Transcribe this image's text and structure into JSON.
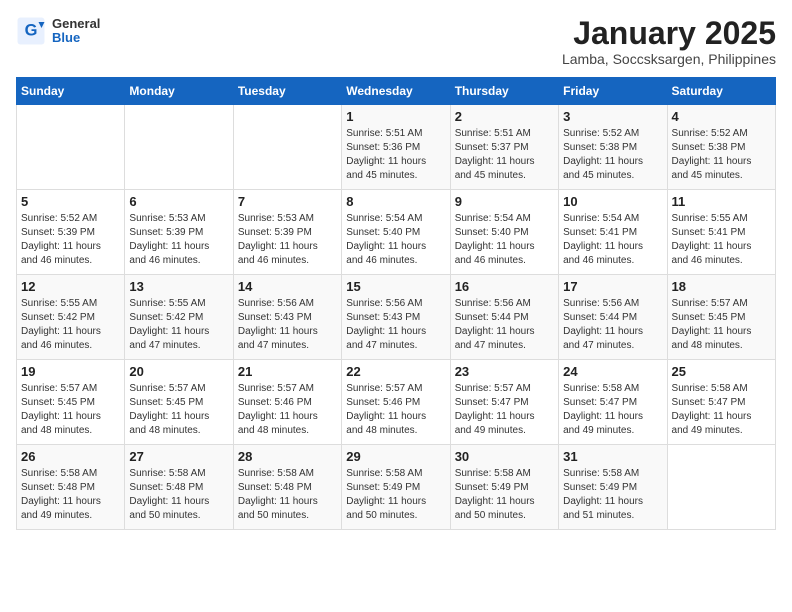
{
  "header": {
    "logo": {
      "general": "General",
      "blue": "Blue"
    },
    "title": "January 2025",
    "subtitle": "Lamba, Soccsksargen, Philippines"
  },
  "days_of_week": [
    "Sunday",
    "Monday",
    "Tuesday",
    "Wednesday",
    "Thursday",
    "Friday",
    "Saturday"
  ],
  "weeks": [
    {
      "days": [
        {
          "date": "",
          "content": ""
        },
        {
          "date": "",
          "content": ""
        },
        {
          "date": "",
          "content": ""
        },
        {
          "date": "1",
          "content": "Sunrise: 5:51 AM\nSunset: 5:36 PM\nDaylight: 11 hours\nand 45 minutes."
        },
        {
          "date": "2",
          "content": "Sunrise: 5:51 AM\nSunset: 5:37 PM\nDaylight: 11 hours\nand 45 minutes."
        },
        {
          "date": "3",
          "content": "Sunrise: 5:52 AM\nSunset: 5:38 PM\nDaylight: 11 hours\nand 45 minutes."
        },
        {
          "date": "4",
          "content": "Sunrise: 5:52 AM\nSunset: 5:38 PM\nDaylight: 11 hours\nand 45 minutes."
        }
      ]
    },
    {
      "days": [
        {
          "date": "5",
          "content": "Sunrise: 5:52 AM\nSunset: 5:39 PM\nDaylight: 11 hours\nand 46 minutes."
        },
        {
          "date": "6",
          "content": "Sunrise: 5:53 AM\nSunset: 5:39 PM\nDaylight: 11 hours\nand 46 minutes."
        },
        {
          "date": "7",
          "content": "Sunrise: 5:53 AM\nSunset: 5:39 PM\nDaylight: 11 hours\nand 46 minutes."
        },
        {
          "date": "8",
          "content": "Sunrise: 5:54 AM\nSunset: 5:40 PM\nDaylight: 11 hours\nand 46 minutes."
        },
        {
          "date": "9",
          "content": "Sunrise: 5:54 AM\nSunset: 5:40 PM\nDaylight: 11 hours\nand 46 minutes."
        },
        {
          "date": "10",
          "content": "Sunrise: 5:54 AM\nSunset: 5:41 PM\nDaylight: 11 hours\nand 46 minutes."
        },
        {
          "date": "11",
          "content": "Sunrise: 5:55 AM\nSunset: 5:41 PM\nDaylight: 11 hours\nand 46 minutes."
        }
      ]
    },
    {
      "days": [
        {
          "date": "12",
          "content": "Sunrise: 5:55 AM\nSunset: 5:42 PM\nDaylight: 11 hours\nand 46 minutes."
        },
        {
          "date": "13",
          "content": "Sunrise: 5:55 AM\nSunset: 5:42 PM\nDaylight: 11 hours\nand 47 minutes."
        },
        {
          "date": "14",
          "content": "Sunrise: 5:56 AM\nSunset: 5:43 PM\nDaylight: 11 hours\nand 47 minutes."
        },
        {
          "date": "15",
          "content": "Sunrise: 5:56 AM\nSunset: 5:43 PM\nDaylight: 11 hours\nand 47 minutes."
        },
        {
          "date": "16",
          "content": "Sunrise: 5:56 AM\nSunset: 5:44 PM\nDaylight: 11 hours\nand 47 minutes."
        },
        {
          "date": "17",
          "content": "Sunrise: 5:56 AM\nSunset: 5:44 PM\nDaylight: 11 hours\nand 47 minutes."
        },
        {
          "date": "18",
          "content": "Sunrise: 5:57 AM\nSunset: 5:45 PM\nDaylight: 11 hours\nand 48 minutes."
        }
      ]
    },
    {
      "days": [
        {
          "date": "19",
          "content": "Sunrise: 5:57 AM\nSunset: 5:45 PM\nDaylight: 11 hours\nand 48 minutes."
        },
        {
          "date": "20",
          "content": "Sunrise: 5:57 AM\nSunset: 5:45 PM\nDaylight: 11 hours\nand 48 minutes."
        },
        {
          "date": "21",
          "content": "Sunrise: 5:57 AM\nSunset: 5:46 PM\nDaylight: 11 hours\nand 48 minutes."
        },
        {
          "date": "22",
          "content": "Sunrise: 5:57 AM\nSunset: 5:46 PM\nDaylight: 11 hours\nand 48 minutes."
        },
        {
          "date": "23",
          "content": "Sunrise: 5:57 AM\nSunset: 5:47 PM\nDaylight: 11 hours\nand 49 minutes."
        },
        {
          "date": "24",
          "content": "Sunrise: 5:58 AM\nSunset: 5:47 PM\nDaylight: 11 hours\nand 49 minutes."
        },
        {
          "date": "25",
          "content": "Sunrise: 5:58 AM\nSunset: 5:47 PM\nDaylight: 11 hours\nand 49 minutes."
        }
      ]
    },
    {
      "days": [
        {
          "date": "26",
          "content": "Sunrise: 5:58 AM\nSunset: 5:48 PM\nDaylight: 11 hours\nand 49 minutes."
        },
        {
          "date": "27",
          "content": "Sunrise: 5:58 AM\nSunset: 5:48 PM\nDaylight: 11 hours\nand 50 minutes."
        },
        {
          "date": "28",
          "content": "Sunrise: 5:58 AM\nSunset: 5:48 PM\nDaylight: 11 hours\nand 50 minutes."
        },
        {
          "date": "29",
          "content": "Sunrise: 5:58 AM\nSunset: 5:49 PM\nDaylight: 11 hours\nand 50 minutes."
        },
        {
          "date": "30",
          "content": "Sunrise: 5:58 AM\nSunset: 5:49 PM\nDaylight: 11 hours\nand 50 minutes."
        },
        {
          "date": "31",
          "content": "Sunrise: 5:58 AM\nSunset: 5:49 PM\nDaylight: 11 hours\nand 51 minutes."
        },
        {
          "date": "",
          "content": ""
        }
      ]
    }
  ]
}
